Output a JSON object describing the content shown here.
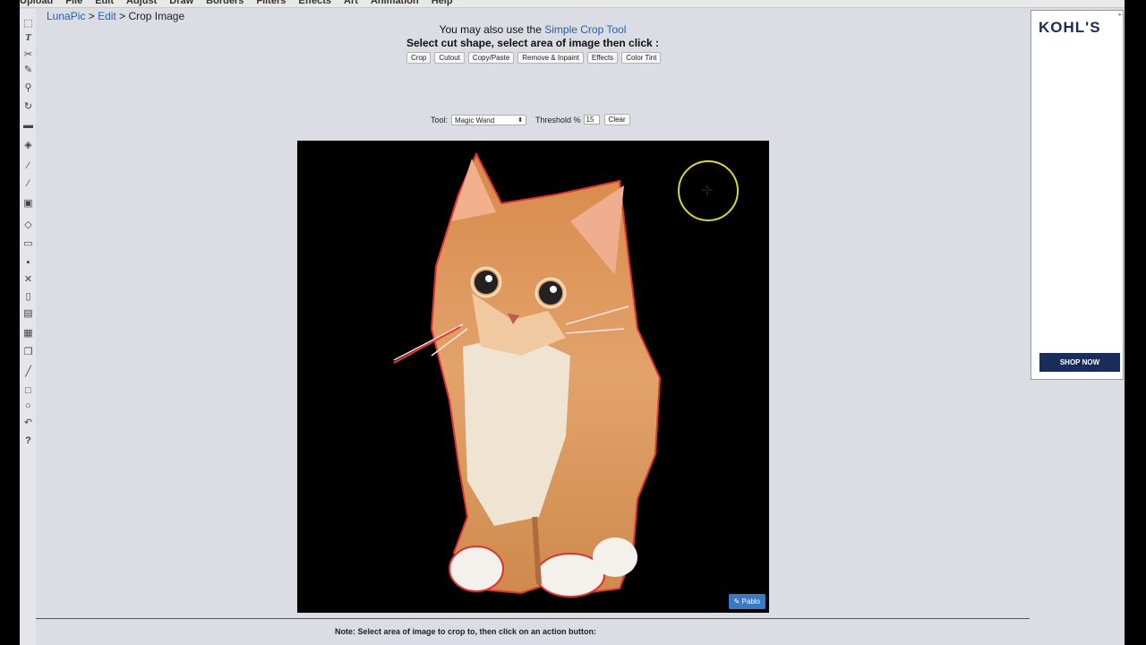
{
  "menu": [
    "Upload",
    "File",
    "Edit",
    "Adjust",
    "Draw",
    "Borders",
    "Filters",
    "Effects",
    "Art",
    "Animation",
    "Help"
  ],
  "toolbar_icons": [
    "select-icon",
    "text-icon",
    "scissors-icon",
    "pencil-icon",
    "magnifier-icon",
    "rotate-icon",
    "panel-icon",
    "paint-bucket-icon",
    "eyedropper-icon",
    "brush-icon",
    "crop-icon",
    "eraser-icon",
    "open-folder-icon",
    "save-icon",
    "close-icon",
    "new-file-icon",
    "print-icon",
    "layers-icon",
    "copy-icon",
    "line-icon",
    "rectangle-icon",
    "circle-icon",
    "undo-icon",
    "help-icon"
  ],
  "breadcrumb": {
    "home": "LunaPic",
    "sep1": " > ",
    "edit": "Edit",
    "sep2": " > ",
    "current": "Crop Image"
  },
  "header": {
    "line1_prefix": "You may also use the ",
    "line1_link": "Simple Crop Tool",
    "line2": "Select cut shape, select area of image then click :"
  },
  "actions": [
    "Crop",
    "Cutout",
    "Copy/Paste",
    "Remove & Inpaint",
    "Effects",
    "Color Tint"
  ],
  "tool": {
    "label": "Tool:",
    "selected": "Magic Wand",
    "threshold_label": "Threshold %",
    "threshold_value": "15",
    "clear_label": "Clear"
  },
  "canvas": {
    "badge": "Pablo"
  },
  "footer": {
    "note": "Note: Select area of image to crop to, then click on an action button:"
  },
  "ad": {
    "logo": "KOHL'S",
    "button": "SHOP NOW"
  }
}
